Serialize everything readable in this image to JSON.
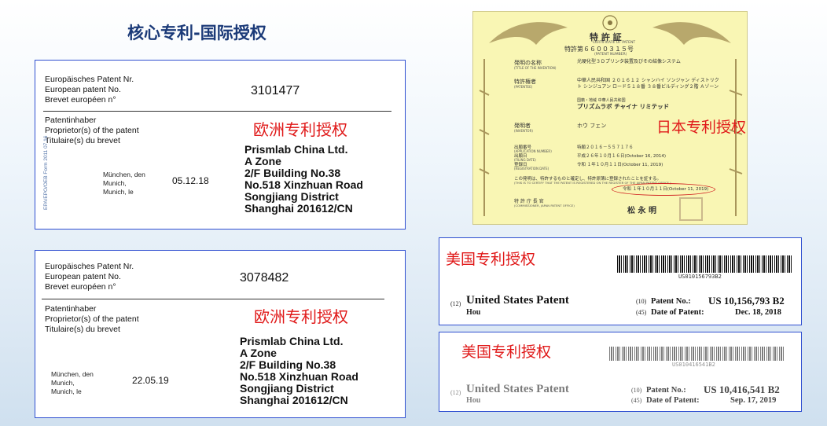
{
  "title": "核心专利-国际授权",
  "ep1": {
    "nr_label": [
      "Europäisches Patent Nr.",
      "European patent No.",
      "Brevet européen n°"
    ],
    "number": "3101477",
    "holder_label": [
      "Patentinhaber",
      "Proprietor(s) of the patent",
      "Titulaire(s) du brevet"
    ],
    "stamp": "欧洲专利授权",
    "city": [
      "München, den",
      "Munich,",
      "Munich, le"
    ],
    "date": "05.12.18",
    "address": [
      "Prismlab China Ltd.",
      "A Zone",
      "2/F Building No.38",
      "No.518 Xinzhuan Road",
      "Songjiang District",
      "Shanghai 201612/CN"
    ],
    "side_text": "EPA/EPO/OEB Form 2011 07.16"
  },
  "ep2": {
    "nr_label": [
      "Europäisches Patent Nr.",
      "European patent No.",
      "Brevet européen n°"
    ],
    "number": "3078482",
    "holder_label": [
      "Patentinhaber",
      "Proprietor(s) of the patent",
      "Titulaire(s) du brevet"
    ],
    "stamp": "欧洲专利授权",
    "city": [
      "München, den",
      "Munich,",
      "Munich, le"
    ],
    "date": "22.05.19",
    "address": [
      "Prismlab China Ltd.",
      "A Zone",
      "2/F Building No.38",
      "No.518 Xinzhuan Road",
      "Songjiang District",
      "Shanghai 201612/CN"
    ]
  },
  "jp": {
    "heading": "特 許 証",
    "heading_sub": "CERTIFICATE OF PATENT",
    "patent_no": "特許第６６００３１５号",
    "patent_no_sub": "(PATENT NUMBER)",
    "rows": [
      {
        "label": "発明の名称",
        "sub": "(TITLE OF THE INVENTION)",
        "value": "光硬化型３Ｄプリンタ装置及びその結像システム"
      },
      {
        "label": "特許権者",
        "sub": "(PATENTEE)",
        "value": "中華人民共和国 ２０１６１２ シャンハイ ソンジャン ディストリクト シンジュアン ロード５１８番 ３８番ビルディング２階 Ａゾーン"
      },
      {
        "label": "",
        "sub": "",
        "value": "国籍・地域 中華人民共和国"
      },
      {
        "label": "",
        "sub": "",
        "value": "プリズムラボ チャイナ リミテッド"
      },
      {
        "label": "発明者",
        "sub": "(INVENTOR)",
        "value": "ホウ フェン"
      },
      {
        "label": "出願番号",
        "sub": "(APPLICATION NUMBER)",
        "value": "特願２０１６－５５７１７６"
      },
      {
        "label": "出願日",
        "sub": "(FILING DATE)",
        "value": "平成２６年１０月１６日(October 16, 2014)"
      },
      {
        "label": "登録日",
        "sub": "(REGISTRATION DATE)",
        "value": "令和 １年１０月１１日(October 11, 2019)"
      }
    ],
    "statement": "この発明は、特許するものと確定し、特許原簿に登録されたことを証する。",
    "statement_en": "(THIS IS TO CERTIFY THAT THE PATENT IS REGISTERED ON THE REGISTER OF THE JAPAN PATENT OFFICE.)",
    "date_line": "令和 １年１０月１１日(October 11, 2019)",
    "commissioner": "特 許 庁 長 官",
    "commissioner_sub": "(COMMISSIONER, JAPAN PATENT OFFICE)",
    "signature": "松 永 明",
    "stamp": "日本专利授权"
  },
  "us1": {
    "stamp": "美国专利授权",
    "barcode_text": "US010156793B2",
    "code12": "(12)",
    "title": "United States Patent",
    "inventor": "Hou",
    "code10": "(10)",
    "patent_no_label": "Patent No.:",
    "patent_no": "US 10,156,793 B2",
    "code45": "(45)",
    "date_label": "Date of Patent:",
    "date": "Dec. 18, 2018"
  },
  "us2": {
    "stamp": "美国专利授权",
    "barcode_text": "US010416541B2",
    "code12": "(12)",
    "title": "United States Patent",
    "inventor": "Hou",
    "code10": "(10)",
    "patent_no_label": "Patent No.:",
    "patent_no": "US 10,416,541 B2",
    "code45": "(45)",
    "date_label": "Date of Patent:",
    "date": "Sep. 17, 2019"
  }
}
